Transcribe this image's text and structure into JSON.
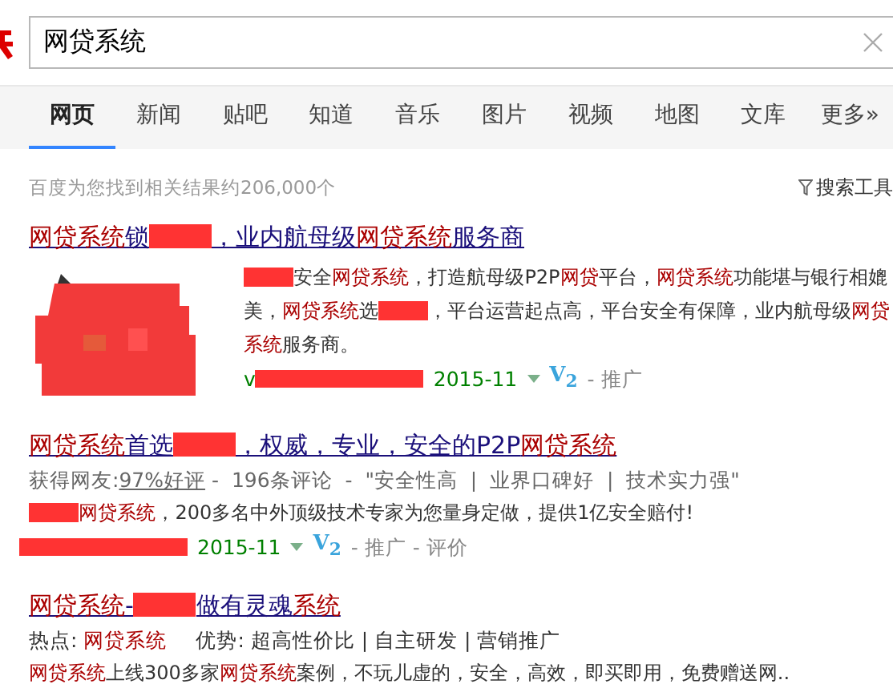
{
  "search": {
    "value": "网贷系统"
  },
  "tabs": [
    {
      "label": "网页",
      "selected": true
    },
    {
      "label": "新闻",
      "selected": false
    },
    {
      "label": "贴吧",
      "selected": false
    },
    {
      "label": "知道",
      "selected": false
    },
    {
      "label": "音乐",
      "selected": false
    },
    {
      "label": "图片",
      "selected": false
    },
    {
      "label": "视频",
      "selected": false
    },
    {
      "label": "地图",
      "selected": false
    },
    {
      "label": "文库",
      "selected": false
    },
    {
      "label": "更多»",
      "selected": false
    }
  ],
  "result_count": "百度为您找到相关结果约206,000个",
  "search_tools": "搜索工具",
  "results": [
    {
      "title": [
        {
          "kind": "keyword",
          "text": "网贷系统"
        },
        {
          "kind": "text",
          "text": "锁"
        },
        {
          "kind": "redaction"
        },
        {
          "kind": "text",
          "text": "，业内航母级"
        },
        {
          "kind": "keyword",
          "text": "网贷系统"
        },
        {
          "kind": "text",
          "text": "服务商"
        }
      ],
      "thumbnail": {
        "kind": "redacted"
      },
      "description": [
        {
          "kind": "redaction"
        },
        {
          "kind": "text",
          "text": "安全"
        },
        {
          "kind": "keyword",
          "text": "网贷系统"
        },
        {
          "kind": "text",
          "text": "，打造航母级P2P"
        },
        {
          "kind": "keyword",
          "text": "网贷"
        },
        {
          "kind": "text",
          "text": "平台，"
        },
        {
          "kind": "keyword",
          "text": "网贷系统"
        },
        {
          "kind": "text",
          "text": "功能堪与银行相媲美，"
        },
        {
          "kind": "keyword",
          "text": "网贷系统"
        },
        {
          "kind": "text",
          "text": "选"
        },
        {
          "kind": "redaction"
        },
        {
          "kind": "text",
          "text": "，平台运营起点高，平台安全有保障，业内航母级"
        },
        {
          "kind": "keyword",
          "text": "网贷系统"
        },
        {
          "kind": "text",
          "text": "服务商。"
        }
      ],
      "url": {
        "prefix": "v",
        "date": "2015-11",
        "badge": "V$_{2}$",
        "tail": "- 推广"
      }
    },
    {
      "title": [
        {
          "kind": "keyword",
          "text": "网贷系统"
        },
        {
          "kind": "text",
          "text": "首选"
        },
        {
          "kind": "redaction"
        },
        {
          "kind": "text",
          "text": "，权威，专业，安全的P2P"
        },
        {
          "kind": "keyword",
          "text": "网贷系统"
        }
      ],
      "rating": {
        "prefix": "获得网友:",
        "link": "97%好评",
        "rest": " -  196条评论  -  \"安全性高  |  业界口碑好  |  技术实力强\""
      },
      "description": [
        {
          "kind": "redaction"
        },
        {
          "kind": "keyword",
          "text": "网贷系统"
        },
        {
          "kind": "text",
          "text": "，200多名中外顶级技术专家为您量身定做，提供1亿安全赔付!"
        }
      ],
      "url": {
        "date": "2015-11",
        "badge": "V$_{2}$",
        "tail": "- 推广 - 评价"
      }
    },
    {
      "title": [
        {
          "kind": "keyword",
          "text": "网贷系统"
        },
        {
          "kind": "text",
          "text": "-"
        },
        {
          "kind": "redaction"
        },
        {
          "kind": "text",
          "text": "做有灵魂"
        },
        {
          "kind": "keyword",
          "text": "系统"
        }
      ],
      "hot": {
        "label": "热点:",
        "keyword": "网贷系统",
        "advantage": "优势: 超高性价比 | 自主研发 | 营销推广"
      },
      "description": [
        {
          "kind": "keyword",
          "text": "网贷系统"
        },
        {
          "kind": "text",
          "text": "上线300多家"
        },
        {
          "kind": "keyword",
          "text": "网贷系统"
        },
        {
          "kind": "text",
          "text": "案例，不玩儿虚的，安全，高效，即买即用，免费赠送网.."
        }
      ]
    }
  ]
}
